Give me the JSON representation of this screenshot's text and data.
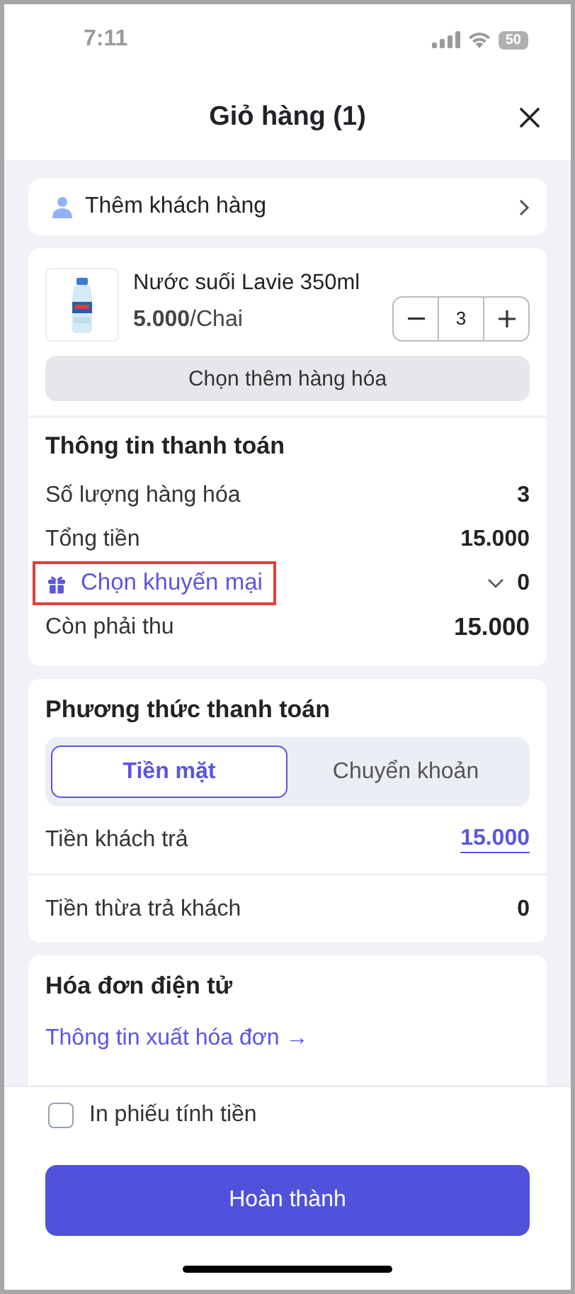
{
  "status_bar": {
    "time": "7:11",
    "battery": "50"
  },
  "header": {
    "title": "Giỏ hàng (1)"
  },
  "customer": {
    "label": "Thêm khách hàng"
  },
  "cart_items": [
    {
      "name": "Nước suối Lavie 350ml",
      "price": "5.000",
      "unit": "/Chai",
      "quantity": "3",
      "kind": "picture"
    }
  ],
  "add_items_button": "Chọn thêm hàng hóa",
  "payment_info": {
    "title": "Thông tin thanh toán",
    "rows": [
      {
        "kind": "plain",
        "label": "Số lượng hàng hóa",
        "value": "3"
      },
      {
        "kind": "plain",
        "label": "Tổng tiền",
        "value": "15.000"
      },
      {
        "kind": "promo",
        "label": "Chọn khuyến mại",
        "value": "0",
        "highlighted": true
      },
      {
        "kind": "total",
        "label": "Còn phải thu",
        "value": "15.000"
      }
    ]
  },
  "payment_method": {
    "title": "Phương thức thanh toán",
    "tabs": [
      {
        "label": "Tiền mặt",
        "selected": true
      },
      {
        "label": "Chuyển khoản",
        "selected": false
      }
    ],
    "rows": [
      {
        "kind": "input",
        "label": "Tiền khách trả",
        "value": "15.000"
      },
      {
        "kind": "plain",
        "label": "Tiền thừa trả khách",
        "value": "0"
      }
    ]
  },
  "e_invoice": {
    "title": "Hóa đơn điện tử",
    "link": "Thông tin xuất hóa đơn →"
  },
  "footer": {
    "print_receipt": {
      "label": "In phiếu tính tiền",
      "checked": false
    },
    "done_button": "Hoàn thành"
  }
}
